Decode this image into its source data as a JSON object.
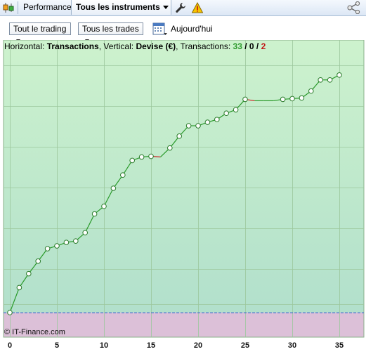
{
  "toolbar": {
    "logo_icon": "candlestick-logo-icon",
    "tab_performance": "Performance",
    "tab_instruments": "Tous les instruments",
    "wrench_icon": "wrench-icon",
    "warning_icon": "warning-icon",
    "share_icon": "share-icon"
  },
  "filters": {
    "trading_select": "Tout le trading",
    "trades_select": "Tous les trades",
    "calendar_icon": "calendar-icon",
    "date_label": "Aujourd'hui"
  },
  "info": {
    "horizontal_label": "Horizontal:",
    "horizontal_value": "Transactions",
    "vertical_label": ", Vertical:",
    "vertical_value": "Devise (€)",
    "transactions_label": ", Transactions:",
    "count_total": "33",
    "slash1": " / ",
    "count_neutral": "0",
    "slash2": " / ",
    "count_loss": "2"
  },
  "watermark": "© IT-Finance.com",
  "colors": {
    "profit_zone": "#c8f0c8",
    "loss_zone": "#dcc0d8",
    "line_up": "#2a9a2a",
    "line_down": "#cc2222",
    "zero_line": "#3050d0"
  },
  "chart_data": {
    "type": "line",
    "title": "",
    "xlabel": "",
    "ylabel": "",
    "xlim": [
      0,
      37.5
    ],
    "ylim": [
      0,
      35.6
    ],
    "x_ticks": [
      "0",
      "5",
      "10",
      "15",
      "20",
      "25",
      "30",
      "35"
    ],
    "grid": true,
    "x": [
      0,
      1,
      2,
      3,
      4,
      5,
      6,
      7,
      8,
      9,
      10,
      11,
      12,
      13,
      14,
      15,
      16,
      17,
      18,
      19,
      20,
      21,
      22,
      23,
      24,
      25,
      26,
      27,
      28,
      29,
      30,
      31,
      32,
      33,
      34,
      35
    ],
    "y": [
      0,
      3.6,
      5.6,
      7.4,
      9.2,
      9.6,
      10.1,
      10.3,
      11.5,
      14.2,
      15.3,
      17.9,
      19.8,
      21.9,
      22.4,
      22.5,
      22.4,
      23.7,
      25.4,
      26.9,
      26.9,
      27.4,
      27.8,
      28.7,
      29.2,
      30.7,
      30.5,
      30.5,
      30.5,
      30.7,
      30.8,
      30.9,
      31.9,
      33.5,
      33.5,
      34.2
    ]
  }
}
